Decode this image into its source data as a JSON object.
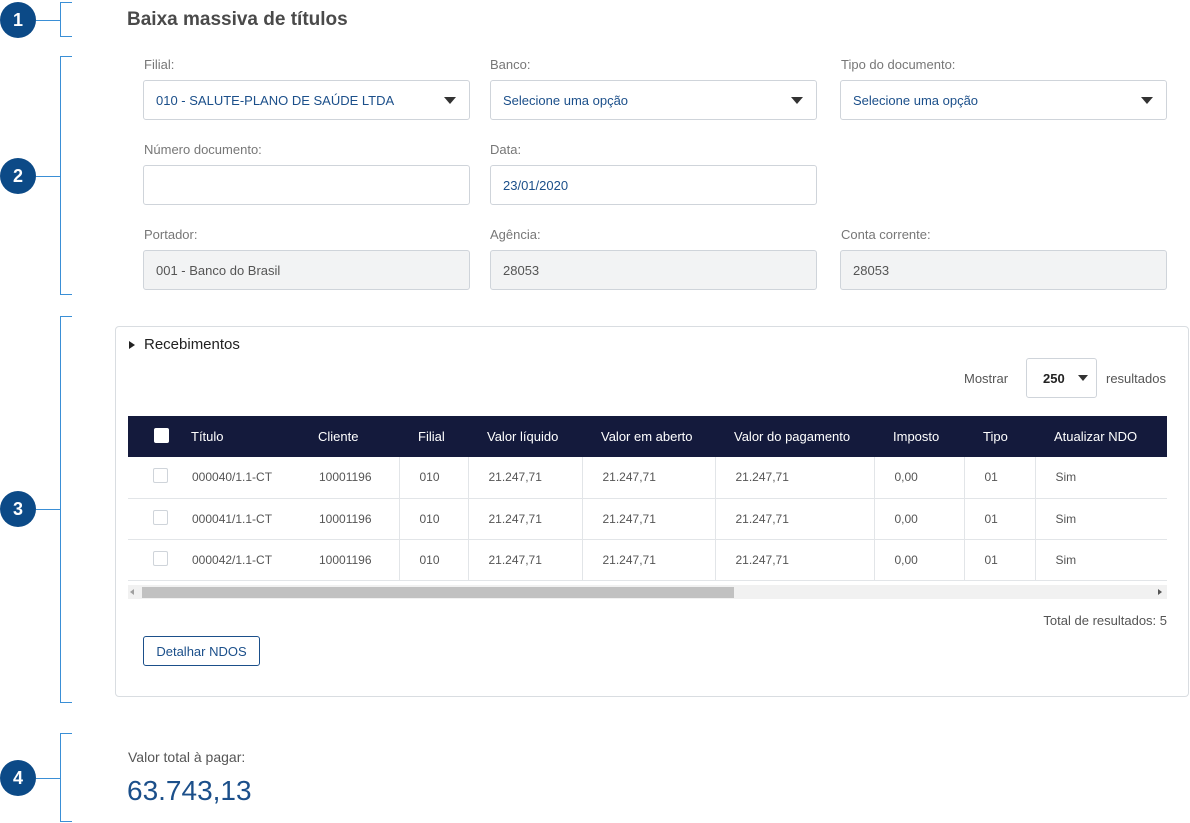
{
  "markers": [
    "1",
    "2",
    "3",
    "4"
  ],
  "page_title": "Baixa massiva de títulos",
  "filters": {
    "filial": {
      "label": "Filial:",
      "value": "010 - SALUTE-PLANO DE SAÚDE LTDA"
    },
    "banco": {
      "label": "Banco:",
      "value": "Selecione uma opção"
    },
    "tipo_documento": {
      "label": "Tipo do documento:",
      "value": "Selecione uma opção"
    },
    "numero_documento": {
      "label": "Número documento:",
      "value": ""
    },
    "data": {
      "label": "Data:",
      "value": "23/01/2020"
    },
    "portador": {
      "label": "Portador:",
      "value": "001 - Banco do Brasil"
    },
    "agencia": {
      "label": "Agência:",
      "value": "28053"
    },
    "conta_corrente": {
      "label": "Conta corrente:",
      "value": "28053"
    }
  },
  "receipts": {
    "title": "Recebimentos",
    "show_label": "Mostrar",
    "page_size": "250",
    "results_label": "resultados",
    "columns": [
      "Título",
      "Cliente",
      "Filial",
      "Valor líquido",
      "Valor em aberto",
      "Valor do pagamento",
      "Imposto",
      "Tipo",
      "Atualizar NDO"
    ],
    "rows": [
      [
        "000040/1.1-CT",
        "10001196",
        "010",
        "21.247,71",
        "21.247,71",
        "21.247,71",
        "0,00",
        "01",
        "Sim"
      ],
      [
        "000041/1.1-CT",
        "10001196",
        "010",
        "21.247,71",
        "21.247,71",
        "21.247,71",
        "0,00",
        "01",
        "Sim"
      ],
      [
        "000042/1.1-CT",
        "10001196",
        "010",
        "21.247,71",
        "21.247,71",
        "21.247,71",
        "0,00",
        "01",
        "Sim"
      ]
    ],
    "total_results": "Total de resultados: 5",
    "detail_button": "Detalhar NDOS"
  },
  "total": {
    "label": "Valor total à pagar:",
    "value": "63.743,13"
  }
}
